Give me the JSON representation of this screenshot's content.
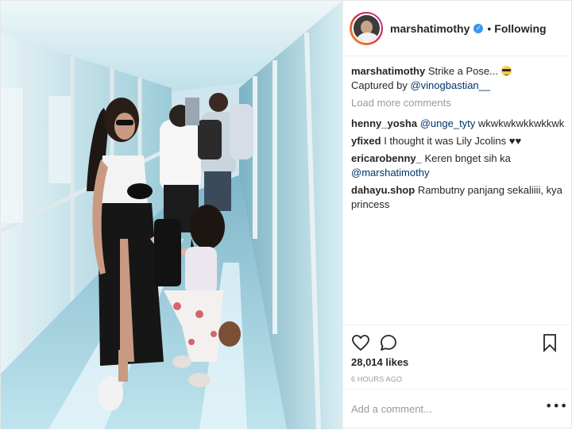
{
  "header": {
    "username": "marshatimothy",
    "verified_symbol": "✓",
    "separator": "•",
    "follow_status": "Following"
  },
  "caption": {
    "username": "marshatimothy",
    "text": "Strike a Pose...",
    "emoji_icon": "sunglasses-emoji-icon",
    "credit_prefix": "Captured by",
    "credit_mention": "@vinogbastian__"
  },
  "load_more_label": "Load more comments",
  "comments": [
    {
      "username": "henny_yosha",
      "mention": "@unge_tyty",
      "text": "wkwkwkwkkwkkwk"
    },
    {
      "username": "yfixed",
      "mention": "",
      "text": "I thought it was Lily Jcolins ♥♥"
    },
    {
      "username": "ericarobenny_",
      "mention": "",
      "text": "Keren bnget sih ka"
    },
    {
      "username": "",
      "mention": "@marshatimothy",
      "text": ""
    },
    {
      "username": "dahayu.shop",
      "mention": "",
      "text": "Rambutny panjang sekaliiii, kya princess"
    }
  ],
  "actions": {
    "like_icon": "heart-icon",
    "comment_icon": "comment-bubble-icon",
    "save_icon": "bookmark-icon"
  },
  "likes_count": "28,014 likes",
  "timestamp": "6 HOURS AGO",
  "add_comment_placeholder": "Add a comment...",
  "more_options_symbol": "•••",
  "colors": {
    "verified": "#3897f0",
    "mention": "#003569",
    "muted": "#999999",
    "text": "#262626"
  }
}
